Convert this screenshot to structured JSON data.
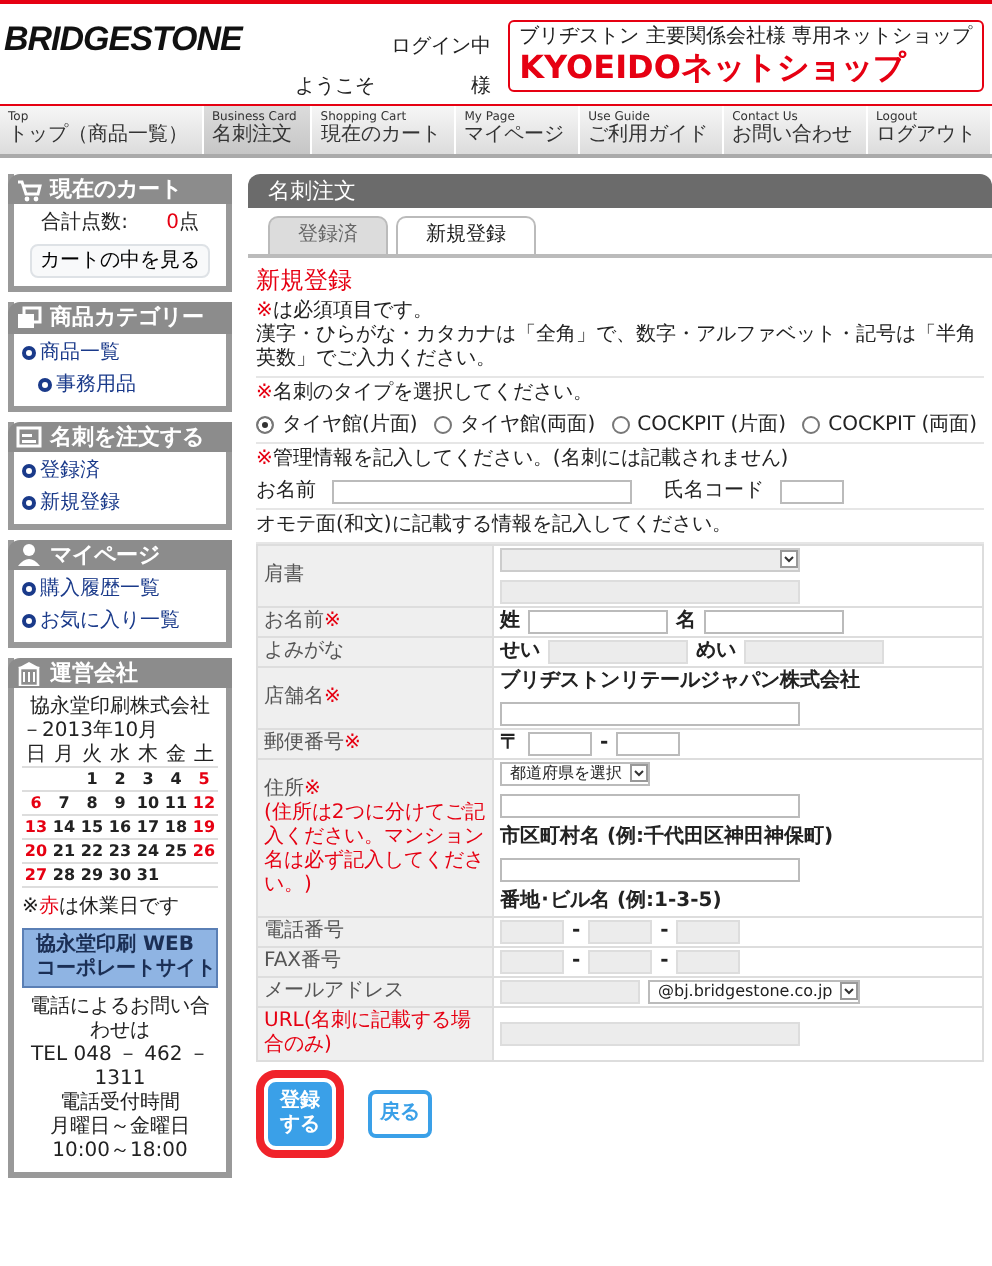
{
  "header": {
    "logo": "BRIDGESTONE",
    "login_status": "ログイン中",
    "welcome": "ようこそ",
    "honorific": "様",
    "shop_tagline": "ブリヂストン 主要関係会社様 専用ネットショップ",
    "shop_name": "KYOEIDOネットショップ"
  },
  "nav": [
    {
      "en": "Top",
      "ja": "トップ（商品一覧）",
      "selected": false
    },
    {
      "en": "Business Card",
      "ja": "名刺注文",
      "selected": true
    },
    {
      "en": "Shopping Cart",
      "ja": "現在のカート",
      "selected": false
    },
    {
      "en": "My Page",
      "ja": "マイページ",
      "selected": false
    },
    {
      "en": "Use Guide",
      "ja": "ご利用ガイド",
      "selected": false
    },
    {
      "en": "Contact Us",
      "ja": "お問い合わせ",
      "selected": false
    },
    {
      "en": "Logout",
      "ja": "ログアウト",
      "selected": false
    }
  ],
  "sidebar": {
    "cart": {
      "title": "現在のカート",
      "count_label": "合計点数:",
      "count": "0",
      "unit": "点",
      "button": "カートの中を見る"
    },
    "menus": [
      {
        "title": "商品カテゴリー",
        "links": [
          {
            "label": "商品一覧",
            "children": [
              {
                "label": "事務用品"
              }
            ]
          }
        ]
      },
      {
        "title": "名刺を注文する",
        "links": [
          {
            "label": "登録済"
          },
          {
            "label": "新規登録"
          }
        ]
      },
      {
        "title": "マイページ",
        "links": [
          {
            "label": "購入履歴一覧"
          },
          {
            "label": "お気に入り一覧"
          }
        ]
      }
    ],
    "company": {
      "title": "運営会社",
      "name": "協永堂印刷株式会社",
      "month": "－2013年10月",
      "weekdays": [
        "日",
        "月",
        "火",
        "水",
        "木",
        "金",
        "土"
      ],
      "weeks": [
        {
          "days": [
            {
              "day": "1",
              "holiday": false
            },
            {
              "day": "2",
              "holiday": false
            },
            {
              "day": "3",
              "holiday": false
            },
            {
              "day": "4",
              "holiday": false
            },
            {
              "day": "5",
              "holiday": true
            }
          ]
        },
        {
          "days": [
            {
              "day": "6",
              "holiday": true
            },
            {
              "day": "7",
              "holiday": false
            },
            {
              "day": "8",
              "holiday": false
            },
            {
              "day": "9",
              "holiday": false
            },
            {
              "day": "10",
              "holiday": false
            },
            {
              "day": "11",
              "holiday": false
            },
            {
              "day": "12",
              "holiday": true
            }
          ]
        },
        {
          "days": [
            {
              "day": "13",
              "holiday": true
            },
            {
              "day": "14",
              "holiday": false
            },
            {
              "day": "15",
              "holiday": false
            },
            {
              "day": "16",
              "holiday": false
            },
            {
              "day": "17",
              "holiday": false
            },
            {
              "day": "18",
              "holiday": false
            },
            {
              "day": "19",
              "holiday": true
            }
          ]
        },
        {
          "days": [
            {
              "day": "20",
              "holiday": true
            },
            {
              "day": "21",
              "holiday": false
            },
            {
              "day": "22",
              "holiday": false
            },
            {
              "day": "23",
              "holiday": false
            },
            {
              "day": "24",
              "holiday": false
            },
            {
              "day": "25",
              "holiday": false
            },
            {
              "day": "26",
              "holiday": true
            }
          ]
        },
        {
          "days": [
            {
              "day": "27",
              "holiday": true
            },
            {
              "day": "28",
              "holiday": false
            },
            {
              "day": "29",
              "holiday": false
            },
            {
              "day": "30",
              "holiday": false
            },
            {
              "day": "31",
              "holiday": false
            }
          ]
        }
      ],
      "note_prefix": "※",
      "note_red": "赤",
      "note_suffix": "は休業日です",
      "banner": [
        "協永堂印刷 WEB",
        "コーポレートサイト"
      ],
      "contact": [
        "電話によるお問い合わせは",
        "TEL 048 － 462 － 1311",
        "電話受付時間",
        "月曜日～金曜日10:00～18:00"
      ]
    }
  },
  "main": {
    "title": "名刺注文",
    "tabs": [
      {
        "label": "登録済",
        "selected": false
      },
      {
        "label": "新規登録",
        "selected": true
      }
    ],
    "heading": "新規登録",
    "required_note": {
      "mark": "※",
      "text": "は必須項目です。",
      "detail": "漢字・ひらがな・カタカナは「全角」で、数字・アルファベット・記号は「半角英数」でご入力ください。"
    },
    "type_prompt": {
      "mark": "※",
      "text": "名刺のタイプを選択してください。"
    },
    "card_types": [
      {
        "label": "タイヤ館(片面)",
        "selected": true
      },
      {
        "label": "タイヤ館(両面)",
        "selected": false
      },
      {
        "label": "COCKPIT (片面)",
        "selected": false
      },
      {
        "label": "COCKPIT (両面)",
        "selected": false
      }
    ],
    "admin_prompt": {
      "mark": "※",
      "text": "管理情報を記入してください。(名刺には記載されません)"
    },
    "admin_fields": [
      {
        "label": "お名前"
      },
      {
        "label": "氏名コード"
      }
    ],
    "front_prompt": "オモテ面(和文)に記載する情報を記入してください。",
    "rows": [
      {
        "label": "肩書",
        "required": false,
        "warning": false,
        "controls": [
          {
            "kind": "select",
            "disabled": true
          },
          {
            "kind": "break"
          },
          {
            "kind": "input",
            "disabled": true
          }
        ]
      },
      {
        "label": "お名前",
        "required": true,
        "warning": false,
        "controls": [
          {
            "kind": "text",
            "text": "姓"
          },
          {
            "kind": "input",
            "disabled": false
          },
          {
            "kind": "text",
            "text": "名"
          },
          {
            "kind": "input",
            "disabled": false
          }
        ]
      },
      {
        "label": "よみがな",
        "required": false,
        "warning": false,
        "controls": [
          {
            "kind": "text",
            "text": "せい"
          },
          {
            "kind": "input",
            "disabled": true
          },
          {
            "kind": "text",
            "text": "めい"
          },
          {
            "kind": "input",
            "disabled": true
          }
        ]
      },
      {
        "label": "店舗名",
        "required": true,
        "warning": false,
        "controls": [
          {
            "kind": "text",
            "text": "ブリヂストンリテールジャパン株式会社"
          },
          {
            "kind": "break"
          },
          {
            "kind": "input",
            "disabled": false
          }
        ]
      },
      {
        "label": "郵便番号",
        "required": true,
        "warning": false,
        "controls": [
          {
            "kind": "text",
            "text": "〒"
          },
          {
            "kind": "input",
            "disabled": false
          },
          {
            "kind": "text",
            "text": "-"
          },
          {
            "kind": "input",
            "disabled": false
          }
        ]
      },
      {
        "label": "住所",
        "required": true,
        "warning": false,
        "note": "(住所は2つに分けてご記入ください。マンション名は必ず記入してください。)",
        "controls": [
          {
            "kind": "select",
            "disabled": false,
            "text": "都道府県を選択"
          },
          {
            "kind": "break"
          },
          {
            "kind": "input",
            "disabled": false
          },
          {
            "kind": "break"
          },
          {
            "kind": "text",
            "text": "市区町村名 (例:千代田区神田神保町)"
          },
          {
            "kind": "break"
          },
          {
            "kind": "input",
            "disabled": false
          },
          {
            "kind": "break"
          },
          {
            "kind": "text",
            "text": "番地･ビル名 (例:1-3-5)"
          }
        ]
      },
      {
        "label": "電話番号",
        "required": false,
        "warning": false,
        "controls": [
          {
            "kind": "input",
            "disabled": true
          },
          {
            "kind": "text",
            "text": "-"
          },
          {
            "kind": "input",
            "disabled": true
          },
          {
            "kind": "text",
            "text": "-"
          },
          {
            "kind": "input",
            "disabled": true
          }
        ]
      },
      {
        "label": "FAX番号",
        "required": false,
        "warning": false,
        "controls": [
          {
            "kind": "input",
            "disabled": true
          },
          {
            "kind": "text",
            "text": "-"
          },
          {
            "kind": "input",
            "disabled": true
          },
          {
            "kind": "text",
            "text": "-"
          },
          {
            "kind": "input",
            "disabled": true
          }
        ]
      },
      {
        "label": "メールアドレス",
        "required": false,
        "warning": false,
        "controls": [
          {
            "kind": "input",
            "disabled": true
          },
          {
            "kind": "select",
            "disabled": false,
            "text": "@bj.bridgestone.co.jp"
          }
        ]
      },
      {
        "label": "URL(名刺に記載する場合のみ)",
        "required": false,
        "warning": true,
        "controls": [
          {
            "kind": "input",
            "disabled": true
          }
        ]
      }
    ],
    "buttons": [
      {
        "label": "登録する",
        "primary": true,
        "highlighted": true
      },
      {
        "label": "戻る",
        "primary": false,
        "highlighted": false
      }
    ]
  }
}
